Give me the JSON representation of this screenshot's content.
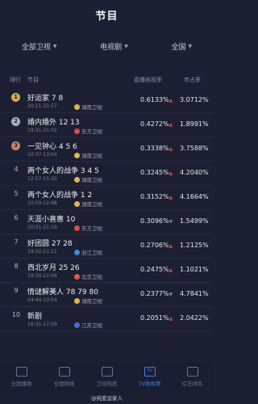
{
  "header": {
    "title": "节目"
  },
  "filters": [
    {
      "label": "全部卫视",
      "caret": "▼"
    },
    {
      "label": "电视剧",
      "caret": "▼"
    },
    {
      "label": "全国",
      "caret": "▼"
    }
  ],
  "columns": {
    "rank": "排行",
    "program": "节目",
    "share": "直播收视率",
    "market": "市占率"
  },
  "rows": [
    {
      "rank": "1",
      "medal": "gold",
      "name": "好运家 7 8",
      "time": "20:11-21:57",
      "channel": "湖南卫视",
      "channel_color": "#e0b84b",
      "share": "0.6133%",
      "market": "3.0712%",
      "dir": "▲"
    },
    {
      "rank": "2",
      "medal": "silver",
      "name": "婚内婚外 12 13",
      "time": "19:31-21:02",
      "channel": "东方卫视",
      "channel_color": "#e04a4a",
      "share": "0.4272%",
      "market": "1.8991%",
      "dir": "▲"
    },
    {
      "rank": "3",
      "medal": "bronze",
      "name": "一见钟心 4 5 6",
      "time": "10:37-13:04",
      "channel": "湖南卫视",
      "channel_color": "#e0b84b",
      "share": "0.3338%",
      "market": "3.7588%",
      "dir": "▲"
    },
    {
      "rank": "4",
      "medal": "",
      "name": "两个女人的战争 3 4 5",
      "time": "12:57-15:20",
      "channel": "湖南卫视",
      "channel_color": "#e0b84b",
      "share": "0.3245%",
      "market": "4.2040%",
      "dir": "▲"
    },
    {
      "rank": "5",
      "medal": "",
      "name": "两个女人的战争 1 2",
      "time": "10:59-12:48",
      "channel": "湖南卫视",
      "channel_color": "#e0b84b",
      "share": "0.3152%",
      "market": "4.1664%",
      "dir": "▲"
    },
    {
      "rank": "6",
      "medal": "",
      "name": "天涯小喜惠 10",
      "time": "20:31-21:19",
      "channel": "东方卫视",
      "channel_color": "#e04a4a",
      "share": "0.3096%",
      "market": "1.5499%",
      "dir": "▼"
    },
    {
      "rank": "7",
      "medal": "",
      "name": "好团圆 27 28",
      "time": "19:32-21:11",
      "channel": "浙江卫视",
      "channel_color": "#4a86d8",
      "share": "0.2706%",
      "market": "1.2125%",
      "dir": "▲"
    },
    {
      "rank": "8",
      "medal": "",
      "name": "西北岁月 25 26",
      "time": "19:30-21:04",
      "channel": "北京卫视",
      "channel_color": "#d85a4a",
      "share": "0.2475%",
      "market": "1.1021%",
      "dir": "▲"
    },
    {
      "rank": "9",
      "medal": "",
      "name": "情谜解美人 78 79 80",
      "time": "04:44-10:54",
      "channel": "湖南卫视",
      "channel_color": "#e0b84b",
      "share": "0.2377%",
      "market": "4.7841%",
      "dir": "▼"
    },
    {
      "rank": "10",
      "medal": "",
      "name": "新剧",
      "time": "16:31-17:59",
      "channel": "江苏卫视",
      "channel_color": "#4a6fd8",
      "share": "0.2051%",
      "market": "2.0422%",
      "dir": "▲"
    }
  ],
  "tabs": [
    {
      "label": "全国播晚",
      "active": false
    },
    {
      "label": "全国网络",
      "active": false
    },
    {
      "label": "卫视热度",
      "active": false
    },
    {
      "label": "TV收视率",
      "active": true
    },
    {
      "label": "综艺排名",
      "active": false
    }
  ],
  "watermark": "@纯爱运家人"
}
